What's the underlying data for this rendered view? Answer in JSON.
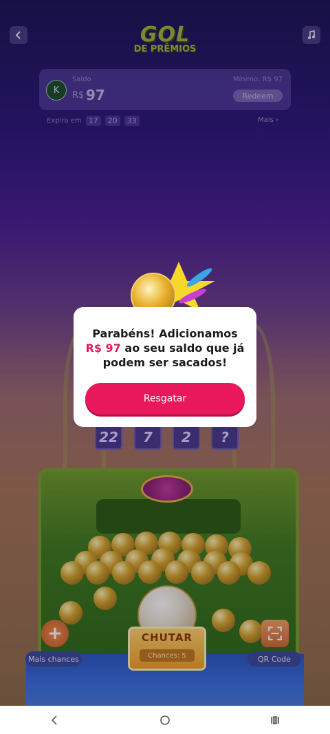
{
  "header": {
    "back_icon": "chevron-left-icon",
    "music_icon": "music-note-icon",
    "logo_title": "GOL",
    "logo_subtitle": "DE PRÊMIOS"
  },
  "balance": {
    "avatar_initial": "K",
    "label": "Saldo",
    "currency": "R$",
    "amount": "97",
    "minimum": "Mínimo: R$ 97",
    "redeem_label": "Redeem",
    "expire_label": "Expira em",
    "timer": [
      "17",
      "20",
      "33"
    ],
    "more_label": "Mais ›"
  },
  "game": {
    "numbers": [
      "22",
      "7",
      "2",
      "?"
    ],
    "shoot_label": "CHUTAR",
    "chances_label": "Chances: 5",
    "more_chances_label": "Mais chances",
    "qr_label": "QR Code"
  },
  "popup": {
    "line1": "Parabéns! Adicionamos",
    "amount": "R$ 97",
    "line2": " ao seu saldo que já",
    "line3": "podem ser sacados!",
    "button_label": "Resgatar",
    "accent_color": "#e8185a"
  },
  "nav": {
    "back_icon": "nav-back-icon",
    "home_icon": "nav-home-icon",
    "recents_icon": "nav-recents-icon"
  }
}
